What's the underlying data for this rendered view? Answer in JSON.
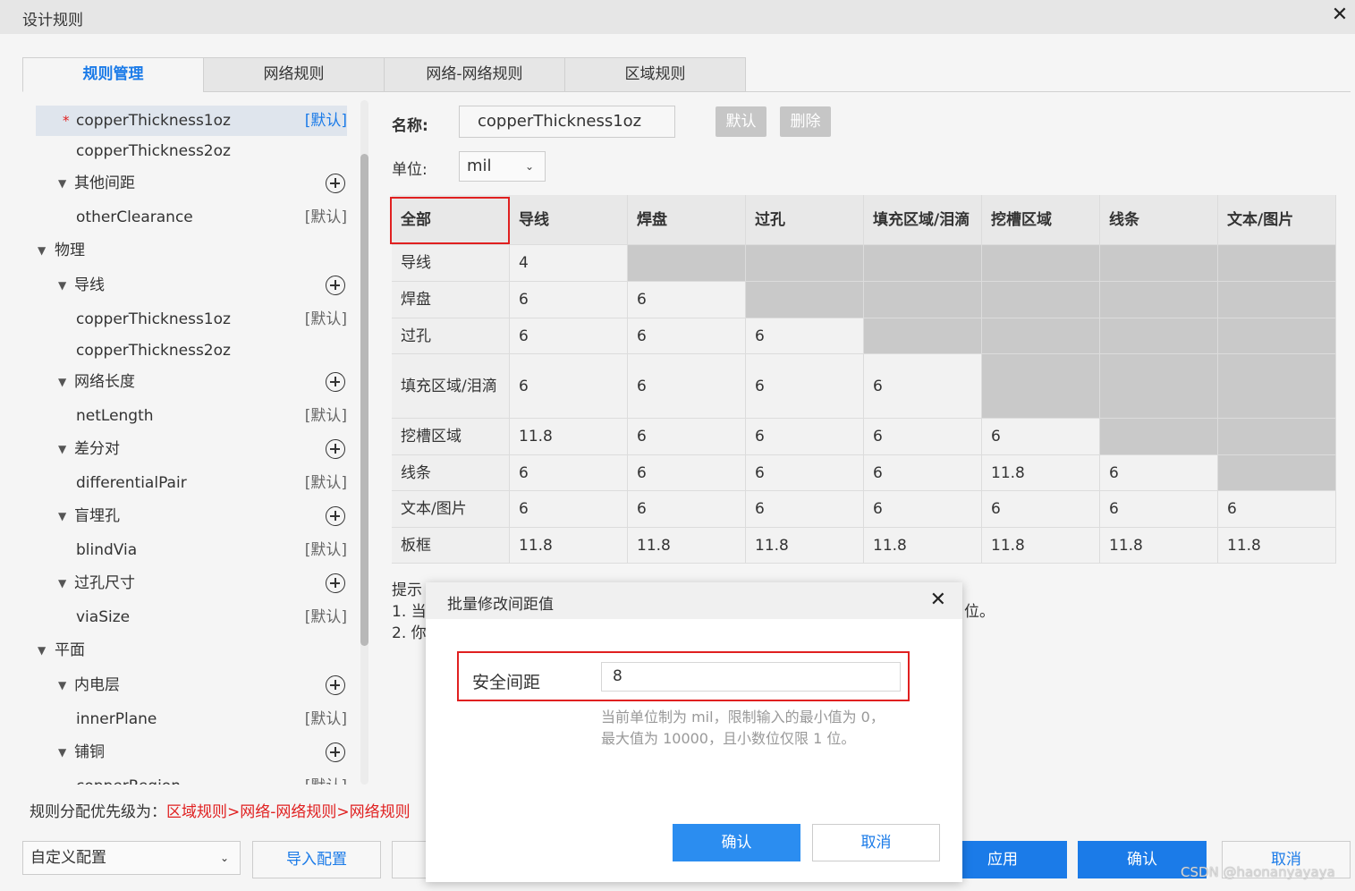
{
  "window": {
    "title": "设计规则"
  },
  "tabs": [
    "规则管理",
    "网络规则",
    "网络-网络规则",
    "区域规则"
  ],
  "tree": {
    "items": [
      {
        "label": "copperThickness1oz",
        "tag": "[默认]",
        "star": "*"
      },
      {
        "label": "copperThickness2oz"
      },
      {
        "label": "其他间距"
      },
      {
        "label": "otherClearance",
        "tag": "[默认]"
      },
      {
        "label": "物理"
      },
      {
        "label": "导线"
      },
      {
        "label": "copperThickness1oz",
        "tag": "[默认]"
      },
      {
        "label": "copperThickness2oz"
      },
      {
        "label": "网络长度"
      },
      {
        "label": "netLength",
        "tag": "[默认]"
      },
      {
        "label": "差分对"
      },
      {
        "label": "differentialPair",
        "tag": "[默认]"
      },
      {
        "label": "盲埋孔"
      },
      {
        "label": "blindVia",
        "tag": "[默认]"
      },
      {
        "label": "过孔尺寸"
      },
      {
        "label": "viaSize",
        "tag": "[默认]"
      },
      {
        "label": "平面"
      },
      {
        "label": "内电层"
      },
      {
        "label": "innerPlane",
        "tag": "[默认]"
      },
      {
        "label": "铺铜"
      },
      {
        "label": "copperRegion",
        "tag": "[默认]"
      }
    ]
  },
  "form": {
    "name_label": "名称:",
    "name_value": "copperThickness1oz",
    "default_btn": "默认",
    "delete_btn": "删除",
    "unit_label": "单位:",
    "unit_value": "mil"
  },
  "matrix": {
    "headers": [
      "全部",
      "导线",
      "焊盘",
      "过孔",
      "填充区域/泪滴",
      "挖槽区域",
      "线条",
      "文本/图片"
    ],
    "rows": [
      {
        "name": "导线",
        "values": [
          "4"
        ]
      },
      {
        "name": "焊盘",
        "values": [
          "6",
          "6"
        ]
      },
      {
        "name": "过孔",
        "values": [
          "6",
          "6",
          "6"
        ]
      },
      {
        "name": "填充区域/泪滴",
        "values": [
          "6",
          "6",
          "6",
          "6"
        ]
      },
      {
        "name": "挖槽区域",
        "values": [
          "11.8",
          "6",
          "6",
          "6",
          "6"
        ]
      },
      {
        "name": "线条",
        "values": [
          "6",
          "6",
          "6",
          "6",
          "11.8",
          "6"
        ]
      },
      {
        "name": "文本/图片",
        "values": [
          "6",
          "6",
          "6",
          "6",
          "6",
          "6",
          "6"
        ]
      },
      {
        "name": "板框",
        "values": [
          "11.8",
          "11.8",
          "11.8",
          "11.8",
          "11.8",
          "11.8",
          "11.8"
        ]
      }
    ]
  },
  "tips": {
    "line0": "提示",
    "line1": "1. 当",
    "line1_end": "位。",
    "line2": "2. 你"
  },
  "priority": {
    "prefix": "规则分配优先级为：",
    "chain": "区域规则>网络-网络规则>网络规则"
  },
  "bottom": {
    "config_value": "自定义配置",
    "import_btn": "导入配置",
    "apply_btn": "应用",
    "confirm_btn": "确认",
    "cancel_btn": "取消"
  },
  "modal": {
    "title": "批量修改间距值",
    "field_label": "安全间距",
    "field_value": "8",
    "hint": "当前单位制为 mil，限制输入的最小值为 0，最大值为 10000，且小数位仅限 1 位。",
    "ok_btn": "确认",
    "cancel_btn": "取消"
  },
  "watermark": "CSDN @haonanyayaya",
  "colors": {
    "accent": "#1b7be8",
    "highlight": "#e02020",
    "disabled": "#c6c6c6"
  }
}
